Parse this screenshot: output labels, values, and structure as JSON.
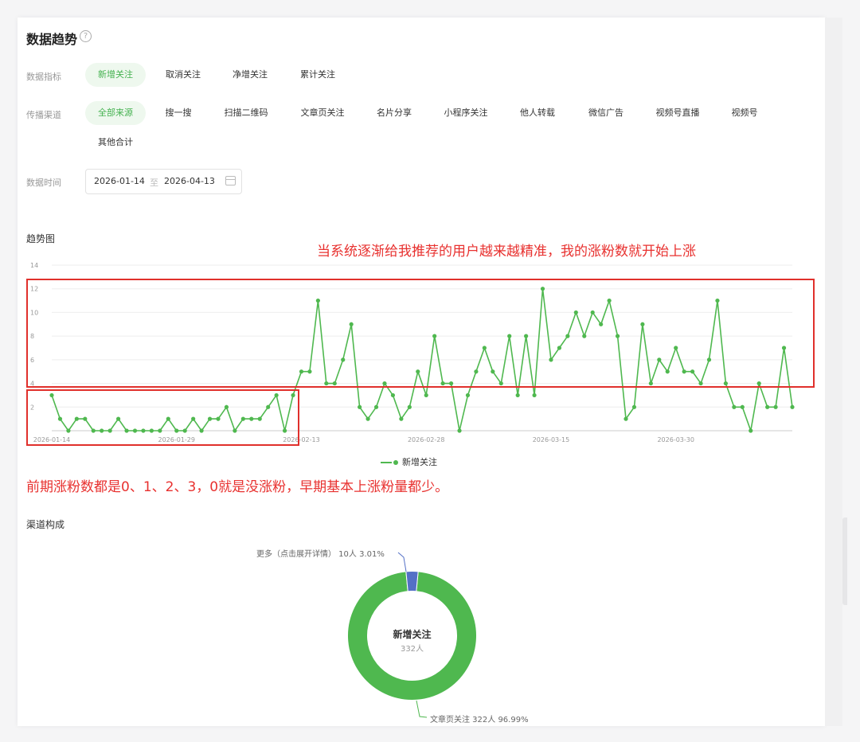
{
  "header": {
    "title": "数据趋势",
    "help_icon": "?"
  },
  "metrics": {
    "label": "数据指标",
    "options": [
      "新增关注",
      "取消关注",
      "净增关注",
      "累计关注"
    ],
    "active": "新增关注"
  },
  "channels": {
    "label": "传播渠道",
    "options": [
      "全部来源",
      "搜一搜",
      "扫描二维码",
      "文章页关注",
      "名片分享",
      "小程序关注",
      "他人转载",
      "微信广告",
      "视频号直播",
      "视频号",
      "其他合计"
    ],
    "active": "全部来源"
  },
  "date_range": {
    "label": "数据时间",
    "start": "2026-01-14",
    "sep": "至",
    "end": "2026-04-13"
  },
  "trend": {
    "title": "趋势图"
  },
  "annotations": {
    "top": "当系统逐渐给我推荐的用户越来越精准，我的涨粉数就开始上涨",
    "bottom": "前期涨粉数都是0、1、2、3，0就是没涨粉，早期基本上涨粉量都少。"
  },
  "colors": {
    "accent": "#4fb84f",
    "annotation": "#e8312f",
    "other_slice": "#5470c6"
  },
  "chart_data": [
    {
      "type": "line",
      "title": "",
      "xlabel": "",
      "ylabel": "",
      "ylim": [
        0,
        14
      ],
      "yticks": [
        2,
        4,
        6,
        8,
        10,
        12,
        14
      ],
      "x_tick_labels": [
        "2026-01-14",
        "2026-01-29",
        "2026-02-13",
        "2026-02-28",
        "2026-03-15",
        "2026-03-30"
      ],
      "x_start": "2026-01-14",
      "x_end": "2026-04-13",
      "grid": true,
      "legend": "bottom",
      "series": [
        {
          "name": "新增关注",
          "values": [
            3,
            1,
            0,
            1,
            1,
            0,
            0,
            0,
            1,
            0,
            0,
            0,
            0,
            0,
            1,
            0,
            0,
            1,
            0,
            1,
            1,
            2,
            0,
            1,
            1,
            1,
            2,
            3,
            0,
            3,
            5,
            5,
            11,
            4,
            4,
            6,
            9,
            2,
            1,
            2,
            4,
            3,
            1,
            2,
            5,
            3,
            8,
            4,
            4,
            0,
            3,
            5,
            7,
            5,
            4,
            8,
            3,
            8,
            3,
            12,
            6,
            7,
            8,
            10,
            8,
            10,
            9,
            11,
            8,
            1,
            2,
            9,
            4,
            6,
            5,
            7,
            5,
            5,
            4,
            6,
            11,
            4,
            2,
            2,
            0,
            4,
            2,
            2,
            7,
            2
          ]
        }
      ]
    },
    {
      "type": "pie",
      "title": "渠道构成",
      "center_title": "新增关注",
      "center_value": "332人",
      "slices": [
        {
          "name": "文章页关注",
          "value": 322,
          "label": "文章页关注 322人 96.99%"
        },
        {
          "name": "更多（点击展开详情）",
          "value": 10,
          "label": "更多（点击展开详情） 10人 3.01%"
        }
      ]
    }
  ]
}
